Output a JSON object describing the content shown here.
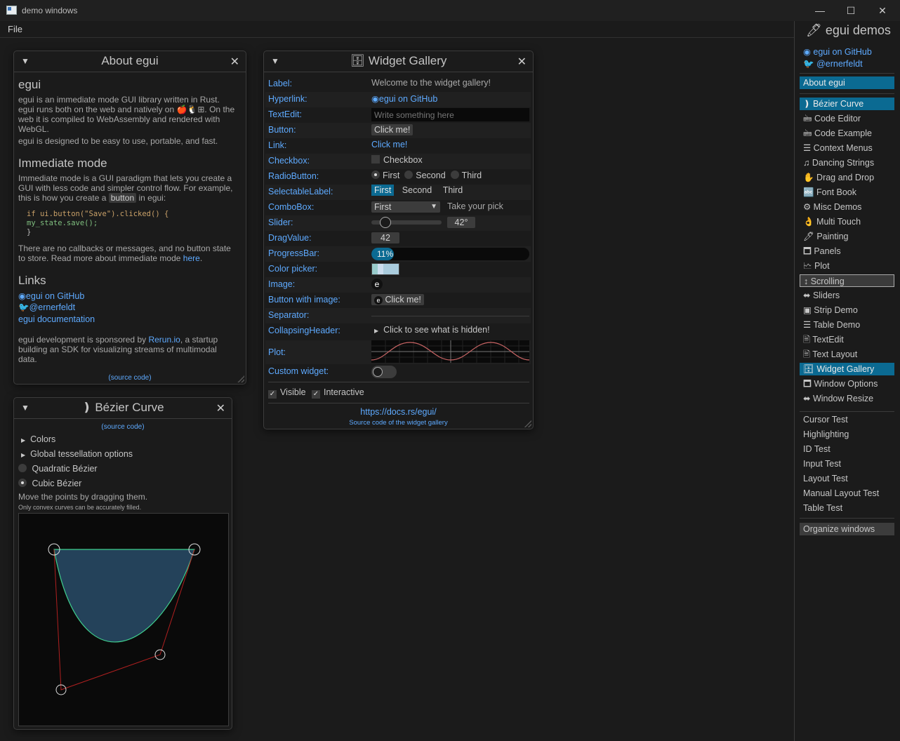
{
  "window": {
    "title": "demo windows",
    "minimize": "—",
    "maximize": "☐",
    "close": "✕"
  },
  "menu": {
    "file": "File"
  },
  "side": {
    "title": "🖊 egui demos",
    "github": "egui on GitHub",
    "twitter": "@ernerfeldt",
    "about": "About egui",
    "demos": [
      "❫ Bézier Curve",
      "🖮 Code Editor",
      "🖮 Code Example",
      "☰ Context Menus",
      "♫ Dancing Strings",
      "✋ Drag and Drop",
      "🔤 Font Book",
      "⚙ Misc Demos",
      "👌 Multi Touch",
      "🖊 Painting",
      "🗖 Panels",
      "🗠 Plot",
      "↕ Scrolling",
      "⬌ Sliders",
      "▣ Strip Demo",
      "☰ Table Demo",
      "🖹 TextEdit",
      "🖹 Text Layout",
      "🗄 Widget Gallery",
      "🗖 Window Options",
      "⬌ Window Resize"
    ],
    "tests": [
      "Cursor Test",
      "Highlighting",
      "ID Test",
      "Input Test",
      "Layout Test",
      "Manual Layout Test",
      "Table Test"
    ],
    "organize": "Organize windows"
  },
  "about": {
    "title": "About egui",
    "heading": "egui",
    "p1a": "egui is an immediate mode GUI library written in Rust.",
    "p1b": "egui runs both on the web and natively on 🍎🐧⊞. On the",
    "p1c": "web it is compiled to WebAssembly and rendered with",
    "p1d": "WebGL.",
    "p2": "egui is designed to be easy to use, portable, and fast.",
    "h_immediate": "Immediate mode",
    "p3a": "Immediate mode is a GUI paradigm that lets you create a",
    "p3b": "GUI with less code and simpler control flow. For example,",
    "p3c_pre": "this is how you create a",
    "p3c_code": "button",
    "p3c_post": "in egui:",
    "code1": "if ui.button(\"Save\").clicked() {",
    "code2": "    my_state.save();",
    "code3": "}",
    "p4a": "There are no callbacks or messages, and no button state",
    "p4b_pre": "to store. Read more about immediate mode",
    "p4b_link": "here",
    "p4b_post": ".",
    "h_links": "Links",
    "link1": "egui on GitHub",
    "link2": "@ernerfeldt",
    "link3": "egui documentation",
    "p5a_pre": "egui development is sponsored by",
    "p5a_link": "Rerun.io",
    "p5a_post": ", a startup",
    "p5b": "building an SDK for visualizing streams of multimodal",
    "p5c": "data.",
    "source": "(source code)"
  },
  "bezier": {
    "title": "❫ Bézier Curve",
    "source": "(source code)",
    "colors": "Colors",
    "tess": "Global tessellation options",
    "quad": "Quadratic Bézier",
    "cubic": "Cubic Bézier",
    "hint": "Move the points by dragging them.",
    "hint2": "Only convex curves can be accurately filled."
  },
  "gallery": {
    "title": "🗄 Widget Gallery",
    "labels": [
      "Label:",
      "Hyperlink:",
      "TextEdit:",
      "Button:",
      "Link:",
      "Checkbox:",
      "RadioButton:",
      "SelectableLabel:",
      "ComboBox:",
      "Slider:",
      "DragValue:",
      "ProgressBar:",
      "Color picker:",
      "Image:",
      "Button with image:",
      "Separator:",
      "CollapsingHeader:",
      "Plot:",
      "Custom widget:"
    ],
    "label_value": "Welcome to the widget gallery!",
    "hyperlink": "egui on GitHub",
    "textedit_placeholder": "Write something here",
    "button": "Click me!",
    "link": "Click me!",
    "checkbox": "Checkbox",
    "radio": [
      "First",
      "Second",
      "Third"
    ],
    "selectable": [
      "First",
      "Second",
      "Third"
    ],
    "combo_value": "First",
    "combo_hint": "Take your pick",
    "slider_value": "42°",
    "slider_fraction": 0.12,
    "drag_value": "42",
    "progress": "11%",
    "progress_fraction": 0.11,
    "image_glyph": "e",
    "img_button": "Click me!",
    "collapsing": "Click to see what is hidden!",
    "visible": "Visible",
    "interactive": "Interactive",
    "docs": "https://docs.rs/egui/",
    "source": "Source code of the widget gallery",
    "accent": "#0b6a92"
  }
}
